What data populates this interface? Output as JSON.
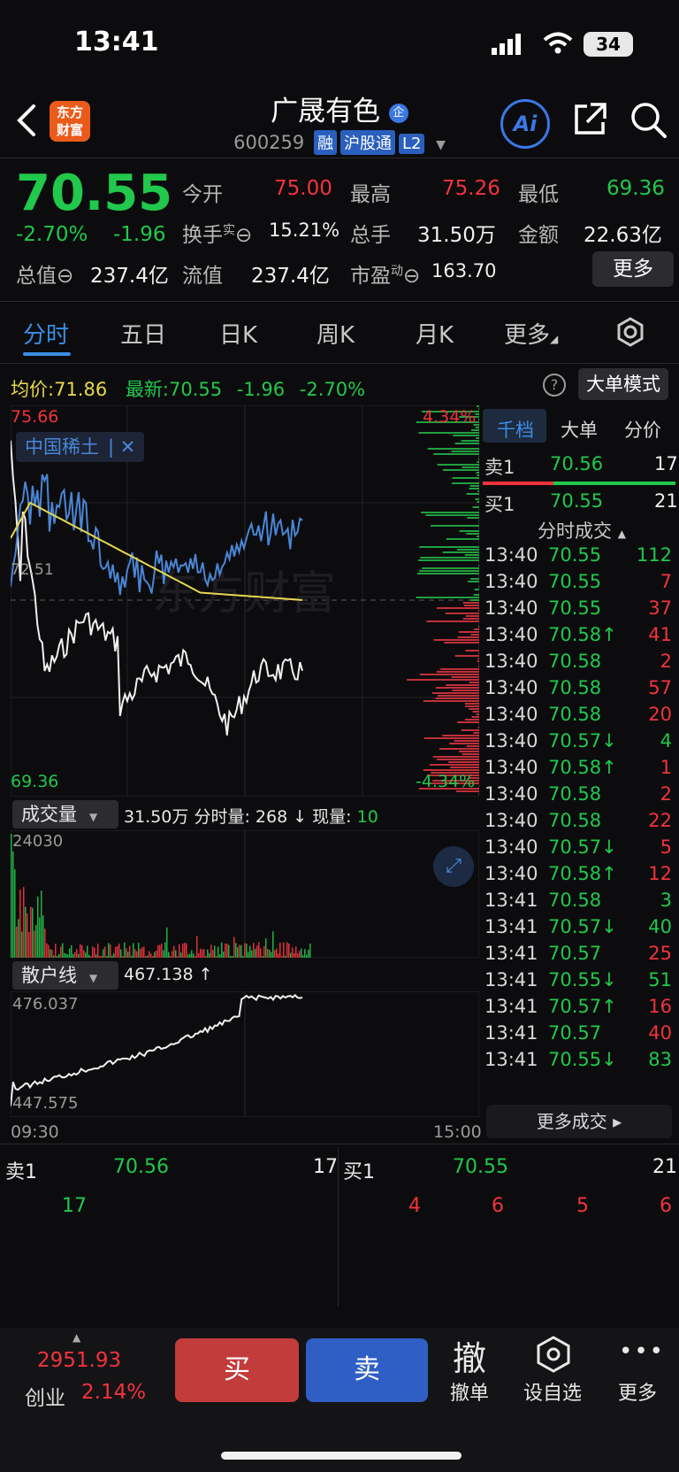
{
  "status_bar": {
    "time": "13:41",
    "battery": "34"
  },
  "header": {
    "name": "广晟有色",
    "name_badge": "企",
    "code": "600259",
    "tags": [
      "融",
      "沪股通",
      "L2"
    ],
    "logo_text": "东方财富",
    "ai_label": "Ai"
  },
  "quote": {
    "price": "70.55",
    "change_pct": "-2.70%",
    "change": "-1.96",
    "open_label": "今开",
    "open": "75.00",
    "high_label": "最高",
    "high": "75.26",
    "low_label": "最低",
    "low": "69.36",
    "turnover_label": "换手",
    "turnover_sup": "实",
    "turnover": "15.21%",
    "volume_label": "总手",
    "volume": "31.50万",
    "amount_label": "金额",
    "amount": "22.63亿",
    "mktcap_label": "总值",
    "mktcap": "237.4亿",
    "float_label": "流值",
    "float": "237.4亿",
    "pe_label": "市盈",
    "pe_sup": "动",
    "pe": "163.70",
    "more_label": "更多"
  },
  "tabs": [
    "分时",
    "五日",
    "日K",
    "周K",
    "月K",
    "更多"
  ],
  "chart_info": {
    "avg_label": "均价:",
    "avg": "71.86",
    "last_label": "最新:",
    "last": "70.55",
    "last_change": "-1.96",
    "last_pct": "-2.70%",
    "big_order_mode": "大单模式",
    "y_max": "75.66",
    "y_min": "69.36",
    "y_mid": "72.51",
    "pct_max": "4.34%",
    "pct_min": "-4.34%",
    "overlay_label": "中国稀土",
    "watermark": "东方财富"
  },
  "volume_panel": {
    "label": "成交量",
    "total": "31.50万",
    "tick_label": "分时量:",
    "tick": "268",
    "now_label": "现量:",
    "now": "10",
    "max": "24030"
  },
  "retail_panel": {
    "label": "散户线",
    "value": "467.138",
    "max": "476.037",
    "min": "447.575",
    "start_time": "09:30",
    "end_time": "15:00"
  },
  "right_panel": {
    "tabs": [
      "千档",
      "大单",
      "分价"
    ],
    "ask1": {
      "label": "卖1",
      "price": "70.56",
      "vol": "17"
    },
    "bid1": {
      "label": "买1",
      "price": "70.55",
      "vol": "21"
    },
    "trades_title": "分时成交",
    "trades": [
      {
        "t": "13:40",
        "p": "70.55",
        "v": "112",
        "a": "",
        "pc": "green",
        "vc": "green"
      },
      {
        "t": "13:40",
        "p": "70.55",
        "v": "7",
        "a": "",
        "pc": "green",
        "vc": "red"
      },
      {
        "t": "13:40",
        "p": "70.55",
        "v": "37",
        "a": "",
        "pc": "green",
        "vc": "red"
      },
      {
        "t": "13:40",
        "p": "70.58",
        "v": "41",
        "a": "↑",
        "pc": "green",
        "vc": "red"
      },
      {
        "t": "13:40",
        "p": "70.58",
        "v": "2",
        "a": "",
        "pc": "green",
        "vc": "red"
      },
      {
        "t": "13:40",
        "p": "70.58",
        "v": "57",
        "a": "",
        "pc": "green",
        "vc": "red"
      },
      {
        "t": "13:40",
        "p": "70.58",
        "v": "20",
        "a": "",
        "pc": "green",
        "vc": "red"
      },
      {
        "t": "13:40",
        "p": "70.57",
        "v": "4",
        "a": "↓",
        "pc": "green",
        "vc": "green"
      },
      {
        "t": "13:40",
        "p": "70.58",
        "v": "1",
        "a": "↑",
        "pc": "green",
        "vc": "red"
      },
      {
        "t": "13:40",
        "p": "70.58",
        "v": "2",
        "a": "",
        "pc": "green",
        "vc": "red"
      },
      {
        "t": "13:40",
        "p": "70.58",
        "v": "22",
        "a": "",
        "pc": "green",
        "vc": "red"
      },
      {
        "t": "13:40",
        "p": "70.57",
        "v": "5",
        "a": "↓",
        "pc": "green",
        "vc": "red"
      },
      {
        "t": "13:40",
        "p": "70.58",
        "v": "12",
        "a": "↑",
        "pc": "green",
        "vc": "red"
      },
      {
        "t": "13:41",
        "p": "70.58",
        "v": "3",
        "a": "",
        "pc": "green",
        "vc": "green"
      },
      {
        "t": "13:41",
        "p": "70.57",
        "v": "40",
        "a": "↓",
        "pc": "green",
        "vc": "green"
      },
      {
        "t": "13:41",
        "p": "70.57",
        "v": "25",
        "a": "",
        "pc": "green",
        "vc": "red"
      },
      {
        "t": "13:41",
        "p": "70.55",
        "v": "51",
        "a": "↓",
        "pc": "green",
        "vc": "green"
      },
      {
        "t": "13:41",
        "p": "70.57",
        "v": "16",
        "a": "↑",
        "pc": "green",
        "vc": "red"
      },
      {
        "t": "13:41",
        "p": "70.57",
        "v": "40",
        "a": "",
        "pc": "green",
        "vc": "red"
      },
      {
        "t": "13:41",
        "p": "70.55",
        "v": "83",
        "a": "↓",
        "pc": "green",
        "vc": "green"
      }
    ],
    "more_trades": "更多成交"
  },
  "bottom_book": {
    "ask": {
      "label": "卖1",
      "price": "70.56",
      "vol": "17",
      "queue": [
        "17"
      ]
    },
    "bid": {
      "label": "买1",
      "price": "70.55",
      "vol": "21",
      "queue": [
        "4",
        "6",
        "5",
        "6"
      ]
    }
  },
  "bottom_bar": {
    "index_value": "2951.93",
    "index_name": "创业",
    "index_pct": "2.14%",
    "buy": "买",
    "sell": "卖",
    "cancel_icon": "撤",
    "cancel": "撤单",
    "watchlist": "设自选",
    "more": "更多"
  },
  "colors": {
    "up": "#f2333c",
    "down": "#21c84b",
    "accent": "#3a8ee6"
  }
}
